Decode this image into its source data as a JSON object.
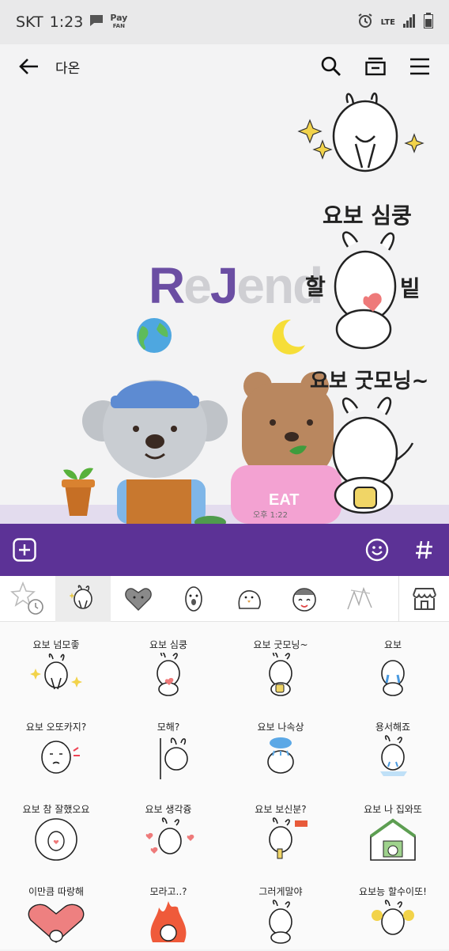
{
  "status_bar": {
    "carrier": "SKT",
    "time": "1:23",
    "pay_label": "Pay",
    "pay_sub": "FAN",
    "network": "LTE"
  },
  "header": {
    "title": "다온"
  },
  "chat": {
    "logo_parts": [
      "R",
      "e",
      "J",
      "end"
    ],
    "stickers": [
      {
        "caption": "요보 심쿵",
        "side_left": "할",
        "side_right": "빝"
      },
      {
        "caption": "요보 굿모닝~"
      }
    ],
    "bubble_text": "EAT",
    "timestamp": "오후 1:22"
  },
  "sticker_tabs": [
    "recent",
    "bunny-current",
    "heart-face",
    "ghost",
    "bird",
    "smile-cat",
    "sketch",
    "store"
  ],
  "sticker_grid": [
    {
      "caption": "요보 넘모좋"
    },
    {
      "caption": "요보 심쿵"
    },
    {
      "caption": "요보 굿모닝~"
    },
    {
      "caption": "요보"
    },
    {
      "caption": "요보 오또카지?"
    },
    {
      "caption": "모해?"
    },
    {
      "caption": "요보 나속상"
    },
    {
      "caption": "용서해죠"
    },
    {
      "caption": "요보 참 잘했오요"
    },
    {
      "caption": "요보 생각즁"
    },
    {
      "caption": "요보 보신분?"
    },
    {
      "caption": "요보 나 집와또"
    },
    {
      "caption": "이만큼 따랑해"
    },
    {
      "caption": "모라고..?"
    },
    {
      "caption": "그러게말야"
    },
    {
      "caption": "요보능 할수이또!"
    }
  ],
  "colors": {
    "accent": "#5c3296",
    "status_bar": "#e9e9ea",
    "logo_purple": "#6b4ea3"
  }
}
